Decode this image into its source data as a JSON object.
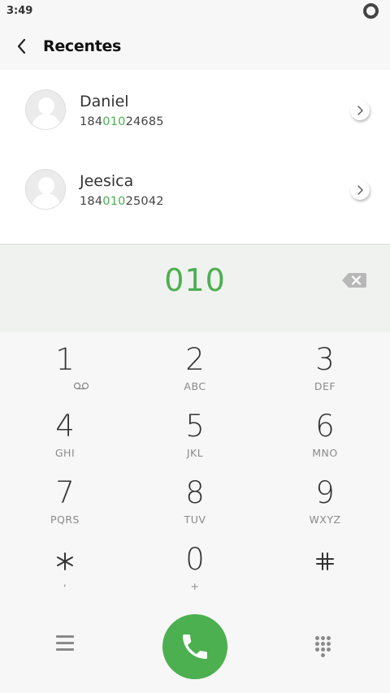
{
  "status_bar": {
    "time": "3:49"
  },
  "header": {
    "title": "Recentes"
  },
  "contacts": [
    {
      "name": "Daniel",
      "number_prefix": "184",
      "number_match": "010",
      "number_suffix": "24685"
    },
    {
      "name": "Jeesica",
      "number_prefix": "184",
      "number_match": "010",
      "number_suffix": "25042"
    }
  ],
  "dialed_number": "010",
  "keypad": [
    {
      "digit": "1",
      "letters": ""
    },
    {
      "digit": "2",
      "letters": "ABC"
    },
    {
      "digit": "3",
      "letters": "DEF"
    },
    {
      "digit": "4",
      "letters": "GHI"
    },
    {
      "digit": "5",
      "letters": "JKL"
    },
    {
      "digit": "6",
      "letters": "MNO"
    },
    {
      "digit": "7",
      "letters": "PQRS"
    },
    {
      "digit": "8",
      "letters": "TUV"
    },
    {
      "digit": "9",
      "letters": "WXYZ"
    },
    {
      "digit": "*",
      "letters": ","
    },
    {
      "digit": "0",
      "letters": "+"
    },
    {
      "digit": "#",
      "letters": ""
    }
  ],
  "icons": {
    "back": "back-arrow-icon",
    "chevron": "chevron-right-icon",
    "backspace": "backspace-icon",
    "voicemail": "voicemail-icon",
    "menu": "menu-icon",
    "call": "phone-icon",
    "dialpad": "dialpad-icon"
  },
  "colors": {
    "accent": "#4caf50",
    "background": "#f7f7f7",
    "display_bg": "#f0f2f0"
  }
}
